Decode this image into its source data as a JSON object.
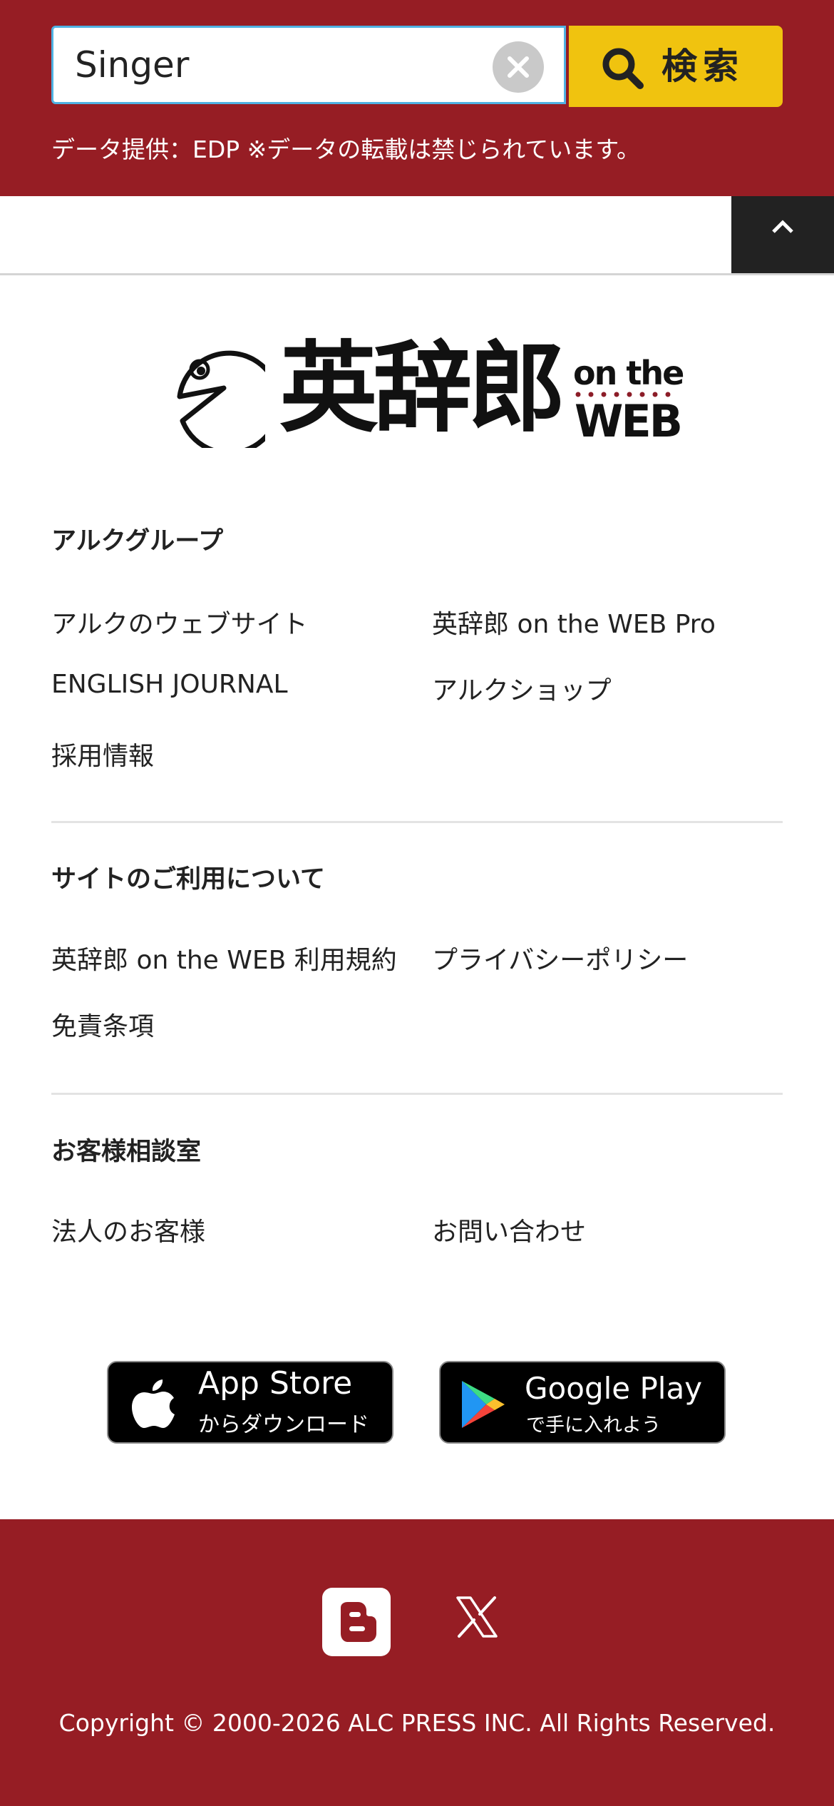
{
  "search": {
    "query": "Singer",
    "button_label": "検索",
    "data_note": "データ提供：EDP ※データの転載は禁じられています。"
  },
  "logo": {
    "main": "英辞郎",
    "sub_top": "on the",
    "sub_bottom": "WEB"
  },
  "sections": {
    "alc_group": {
      "title": "アルクグループ",
      "links": [
        "アルクのウェブサイト",
        "英辞郎 on the WEB Pro",
        "ENGLISH JOURNAL",
        "アルクショップ",
        "採用情報"
      ]
    },
    "site_usage": {
      "title": "サイトのご利用について",
      "links": [
        "英辞郎 on the WEB 利用規約",
        "プライバシーポリシー",
        "免責条項"
      ]
    },
    "support": {
      "title": "お客様相談室",
      "links": [
        "法人のお客様",
        "お問い合わせ"
      ]
    }
  },
  "badges": {
    "app_store": {
      "line1": "App Store",
      "line2": "からダウンロード"
    },
    "google_play": {
      "line1": "Google Play",
      "line2": "で手に入れよう"
    }
  },
  "footer": {
    "copyright": "Copyright © 2000-2026 ALC PRESS INC. All Rights Reserved."
  },
  "colors": {
    "brand_red": "#961d24",
    "search_yellow": "#f0c30f",
    "search_border": "#4fb2e3"
  },
  "icons": [
    "search-icon",
    "clear-icon",
    "chevron-up-icon",
    "apple-icon",
    "google-play-icon",
    "blogger-icon",
    "x-icon"
  ]
}
